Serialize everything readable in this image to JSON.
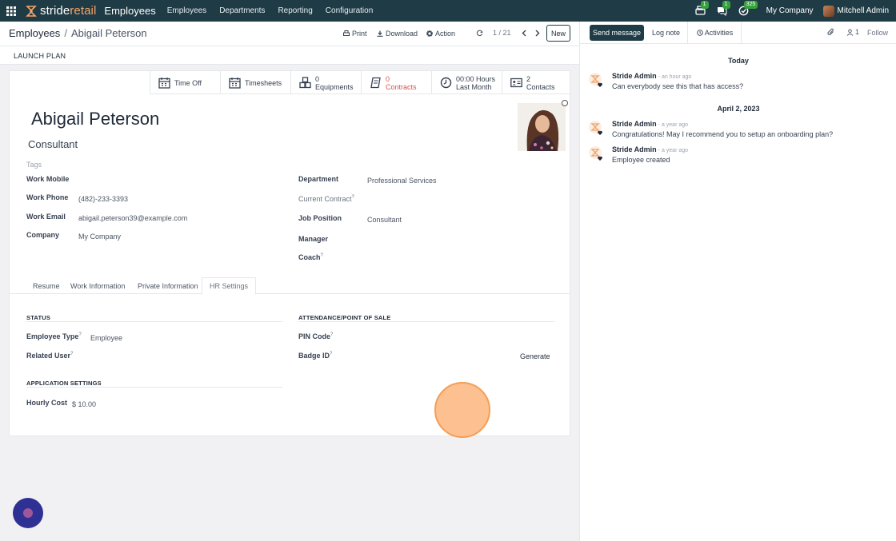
{
  "navbar": {
    "brand_prefix": "stride",
    "brand_suffix": "retail",
    "app_name": "Employees",
    "menus": [
      "Employees",
      "Departments",
      "Reporting",
      "Configuration"
    ],
    "badges": {
      "activity": "1",
      "messages": "1",
      "tasks": "325"
    },
    "company": "My Company",
    "user": "Mitchell Admin",
    "accent_color": "#1f3b45",
    "badge_color": "#35a33b"
  },
  "control": {
    "breadcrumb_parent": "Employees",
    "breadcrumb_sep": "/",
    "breadcrumb_current": "Abigail Peterson",
    "print_label": "Print",
    "download_label": "Download",
    "action_label": "Action",
    "pager_value": "1 / 21",
    "new_label": "New"
  },
  "statusbar": {
    "launch_plan_label": "LAUNCH PLAN"
  },
  "smart_buttons": {
    "time_off": "Time Off",
    "timesheets": "Timesheets",
    "equipments_count": "0",
    "equipments_label": "Equipments",
    "contracts_count": "0",
    "contracts_label": "Contracts",
    "hours_value": "00:00 Hours",
    "hours_label": "Last Month",
    "contacts_count": "2",
    "contacts_label": "Contacts",
    "contracts_color": "#d9534f"
  },
  "employee": {
    "name": "Abigail Peterson",
    "job_title": "Consultant",
    "tags_placeholder": "Tags"
  },
  "fields": {
    "work_mobile_label": "Work Mobile",
    "work_phone_label": "Work Phone",
    "work_phone": "(482)-233-3393",
    "work_email_label": "Work Email",
    "work_email": "abigail.peterson39@example.com",
    "company_label": "Company",
    "company": "My Company",
    "department_label": "Department",
    "department": "Professional Services",
    "current_contract_label": "Current Contract",
    "job_position_label": "Job Position",
    "job_position": "Consultant",
    "manager_label": "Manager",
    "coach_label": "Coach",
    "help_mark": "?"
  },
  "tabs": {
    "resume": "Resume",
    "work_info": "Work Information",
    "private_info": "Private Information",
    "hr_settings": "HR Settings"
  },
  "hr_settings": {
    "status_title": "STATUS",
    "employee_type_label": "Employee Type",
    "employee_type": "Employee",
    "related_user_label": "Related User",
    "attendance_title": "ATTENDANCE/POINT OF SALE",
    "pin_code_label": "PIN Code",
    "badge_id_label": "Badge ID",
    "generate_label": "Generate",
    "app_settings_title": "APPLICATION SETTINGS",
    "hourly_cost_label": "Hourly Cost",
    "hourly_cost": "$ 10.00"
  },
  "chatter": {
    "send_message": "Send message",
    "log_note": "Log note",
    "activities": "Activities",
    "followers_count": "1",
    "follow": "Follow",
    "today": "Today",
    "date_sep": "April 2, 2023",
    "messages": [
      {
        "author": "Stride Admin",
        "time": "- an hour ago",
        "body": "Can everybody see this that has access?"
      },
      {
        "author": "Stride Admin",
        "time": "- a year ago",
        "body": "Congratulations! May I recommend you to setup an onboarding plan?"
      },
      {
        "author": "Stride Admin",
        "time": "- a year ago",
        "body": "Employee created"
      }
    ]
  }
}
